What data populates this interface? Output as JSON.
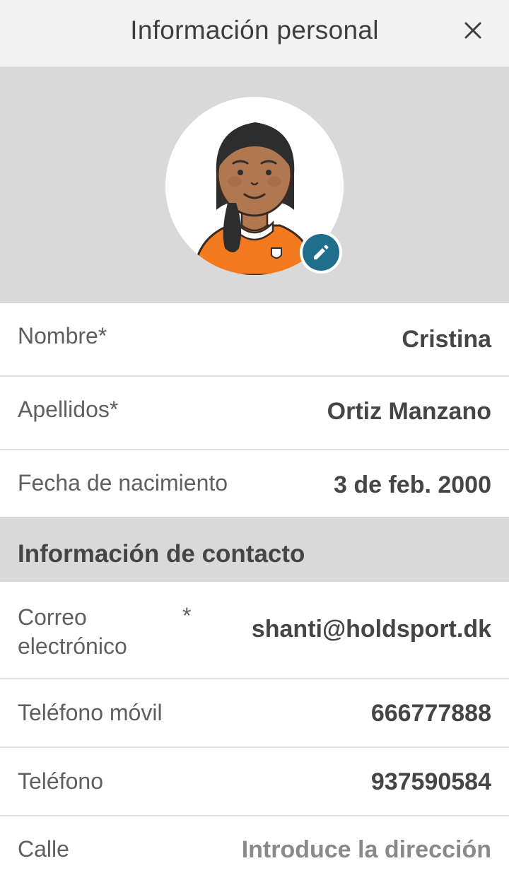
{
  "header": {
    "title": "Información personal",
    "close_icon": "close-icon"
  },
  "profile": {
    "avatar_icon": "avatar-illustration",
    "edit_icon": "pencil-icon",
    "colors": {
      "band": "#d9d9d9",
      "edit_badge": "#1f6e8c",
      "shirt": "#f47a20"
    }
  },
  "personal": {
    "first_name": {
      "label": "Nombre",
      "required": "*",
      "value": "Cristina"
    },
    "last_name": {
      "label": "Apellidos",
      "required": "*",
      "value": "Ortiz Manzano"
    },
    "birthdate": {
      "label": "Fecha de nacimiento",
      "value": "3 de feb. 2000"
    }
  },
  "contact": {
    "section_title": "Información de contacto",
    "email": {
      "label": "Correo electrónico",
      "required": "*",
      "value": "shanti@holdsport.dk"
    },
    "mobile": {
      "label": "Teléfono móvil",
      "value": "666777888"
    },
    "phone": {
      "label": "Teléfono",
      "value": "937590584"
    },
    "street": {
      "label": "Calle",
      "placeholder": "Introduce la dirección"
    }
  }
}
